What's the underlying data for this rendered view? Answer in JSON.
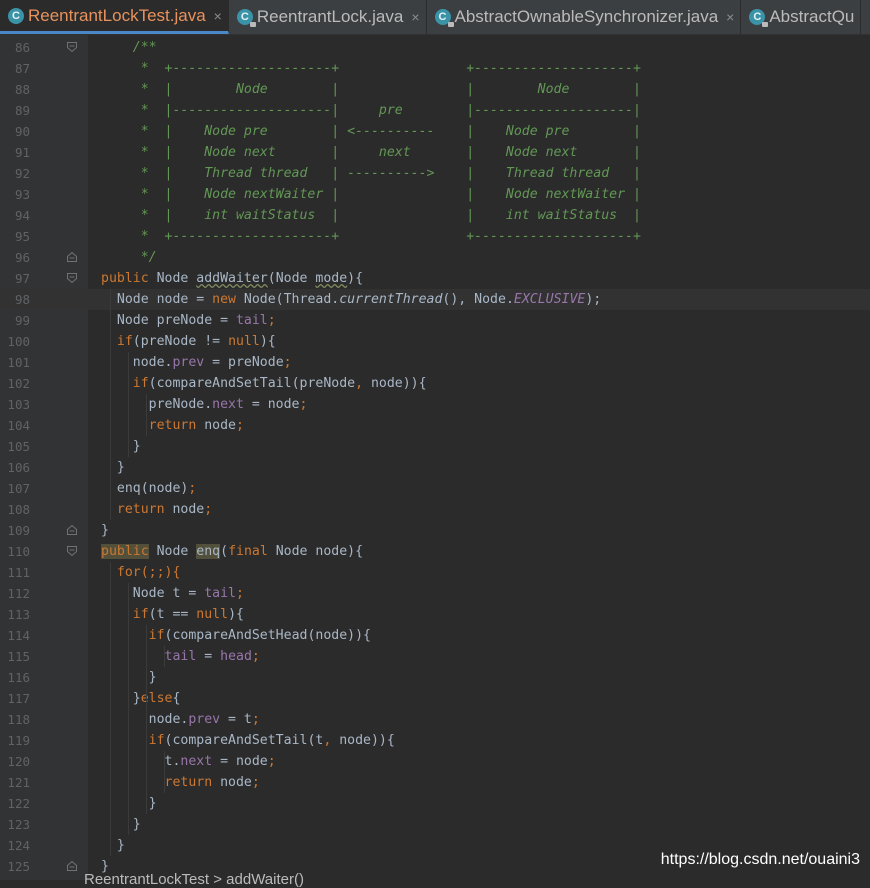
{
  "tabs": [
    {
      "label": "ReentrantLockTest.java",
      "icon": "class-icon",
      "active": true
    },
    {
      "label": "ReentrantLock.java",
      "icon": "locked-class-icon",
      "active": false
    },
    {
      "label": "AbstractOwnableSynchronizer.java",
      "icon": "locked-class-icon",
      "active": false
    },
    {
      "label": "AbstractQu",
      "icon": "locked-class-icon",
      "active": false
    }
  ],
  "current_line": 98,
  "lines": [
    {
      "n": 86,
      "fold": "open",
      "t": [
        [
          "    /**",
          "c"
        ]
      ]
    },
    {
      "n": 87,
      "t": [
        [
          "     *  +--------------------+                +--------------------+",
          "c"
        ]
      ]
    },
    {
      "n": 88,
      "t": [
        [
          "     *  |        Node        |                |        Node        |",
          "c"
        ]
      ]
    },
    {
      "n": 89,
      "t": [
        [
          "     *  |--------------------|     pre        |--------------------|",
          "c"
        ]
      ]
    },
    {
      "n": 90,
      "t": [
        [
          "     *  |    Node pre        | <----------    |    Node pre        |",
          "c"
        ]
      ]
    },
    {
      "n": 91,
      "t": [
        [
          "     *  |    Node next       |     next       |    Node next       |",
          "c"
        ]
      ]
    },
    {
      "n": 92,
      "t": [
        [
          "     *  |    Thread thread   | ---------->    |    Thread thread   |",
          "c"
        ]
      ]
    },
    {
      "n": 93,
      "t": [
        [
          "     *  |    Node nextWaiter |                |    Node nextWaiter |",
          "c"
        ]
      ]
    },
    {
      "n": 94,
      "t": [
        [
          "     *  |    int waitStatus  |                |    int waitStatus  |",
          "c"
        ]
      ]
    },
    {
      "n": 95,
      "t": [
        [
          "     *  +--------------------+                +--------------------+",
          "c"
        ]
      ]
    },
    {
      "n": 96,
      "fold": "close",
      "t": [
        [
          "     */",
          "c"
        ]
      ]
    },
    {
      "n": 97,
      "fold": "open",
      "t": [
        [
          "public",
          "k"
        ],
        [
          " Node "
        ],
        [
          "addWaiter",
          "u"
        ],
        [
          "(Node "
        ],
        [
          "mode",
          "u"
        ],
        [
          "){"
        ]
      ]
    },
    {
      "n": 98,
      "t": [
        [
          "  Node node = "
        ],
        [
          "new",
          "k"
        ],
        [
          " Node(Thread."
        ],
        [
          "currentThread",
          "st"
        ],
        [
          "(), Node."
        ],
        [
          "EXCLUSIVE",
          "sf"
        ],
        [
          ");"
        ]
      ]
    },
    {
      "n": 99,
      "t": [
        [
          "  Node preNode = "
        ],
        [
          "tail",
          "f"
        ],
        [
          ";",
          "k"
        ]
      ]
    },
    {
      "n": 100,
      "t": [
        [
          "  "
        ],
        [
          "if",
          "k"
        ],
        [
          "(preNode != "
        ],
        [
          "null",
          "k"
        ],
        [
          "){"
        ]
      ]
    },
    {
      "n": 101,
      "t": [
        [
          "    node."
        ],
        [
          "prev",
          "f"
        ],
        [
          " = preNode"
        ],
        [
          ";",
          "k"
        ]
      ]
    },
    {
      "n": 102,
      "t": [
        [
          "    "
        ],
        [
          "if",
          "k"
        ],
        [
          "(compareAndSetTail(preNode"
        ],
        [
          ",",
          "k"
        ],
        [
          " node)){"
        ]
      ]
    },
    {
      "n": 103,
      "t": [
        [
          "      preNode."
        ],
        [
          "next",
          "f"
        ],
        [
          " = node"
        ],
        [
          ";",
          "k"
        ]
      ]
    },
    {
      "n": 104,
      "t": [
        [
          "      "
        ],
        [
          "return",
          "k"
        ],
        [
          " node"
        ],
        [
          ";",
          "k"
        ]
      ]
    },
    {
      "n": 105,
      "t": [
        [
          "    }"
        ]
      ]
    },
    {
      "n": 106,
      "t": [
        [
          "  }"
        ]
      ]
    },
    {
      "n": 107,
      "t": [
        [
          "  enq(node)"
        ],
        [
          ";",
          "k"
        ]
      ]
    },
    {
      "n": 108,
      "t": [
        [
          "  "
        ],
        [
          "return",
          "k"
        ],
        [
          " node"
        ],
        [
          ";",
          "k"
        ]
      ]
    },
    {
      "n": 109,
      "fold": "close",
      "t": [
        [
          "}"
        ]
      ]
    },
    {
      "n": 110,
      "fold": "open",
      "t": [
        [
          "public",
          "k hl"
        ],
        [
          " Node "
        ],
        [
          "enq",
          "hl"
        ],
        [
          "("
        ],
        [
          "final",
          "k"
        ],
        [
          " Node node){"
        ]
      ]
    },
    {
      "n": 111,
      "t": [
        [
          "  "
        ],
        [
          "for",
          "k"
        ],
        [
          "(;;){",
          "k"
        ]
      ]
    },
    {
      "n": 112,
      "t": [
        [
          "    Node t = "
        ],
        [
          "tail",
          "f"
        ],
        [
          ";",
          "k"
        ]
      ]
    },
    {
      "n": 113,
      "t": [
        [
          "    "
        ],
        [
          "if",
          "k"
        ],
        [
          "(t == "
        ],
        [
          "null",
          "k"
        ],
        [
          "){"
        ]
      ]
    },
    {
      "n": 114,
      "t": [
        [
          "      "
        ],
        [
          "if",
          "k"
        ],
        [
          "(compareAndSetHead(node)){"
        ]
      ]
    },
    {
      "n": 115,
      "t": [
        [
          "        "
        ],
        [
          "tail",
          "f"
        ],
        [
          " = "
        ],
        [
          "head",
          "f"
        ],
        [
          ";",
          "k"
        ]
      ]
    },
    {
      "n": 116,
      "t": [
        [
          "      }"
        ]
      ]
    },
    {
      "n": 117,
      "t": [
        [
          "    }"
        ],
        [
          "else",
          "k"
        ],
        [
          "{"
        ]
      ]
    },
    {
      "n": 118,
      "t": [
        [
          "      node."
        ],
        [
          "prev",
          "f"
        ],
        [
          " = t"
        ],
        [
          ";",
          "k"
        ]
      ]
    },
    {
      "n": 119,
      "t": [
        [
          "      "
        ],
        [
          "if",
          "k"
        ],
        [
          "(compareAndSetTail(t"
        ],
        [
          ",",
          "k"
        ],
        [
          " node)){"
        ]
      ]
    },
    {
      "n": 120,
      "t": [
        [
          "        t."
        ],
        [
          "next",
          "f"
        ],
        [
          " = node"
        ],
        [
          ";",
          "k"
        ]
      ]
    },
    {
      "n": 121,
      "t": [
        [
          "        "
        ],
        [
          "return",
          "k"
        ],
        [
          " node"
        ],
        [
          ";",
          "k"
        ]
      ]
    },
    {
      "n": 122,
      "t": [
        [
          "      }"
        ]
      ]
    },
    {
      "n": 123,
      "t": [
        [
          "    }"
        ]
      ]
    },
    {
      "n": 124,
      "t": [
        [
          "  }"
        ]
      ]
    },
    {
      "n": 125,
      "fold": "close",
      "t": [
        [
          "}"
        ]
      ]
    }
  ],
  "breadcrumb": "ReentrantLockTest  >  addWaiter()",
  "watermark": "https://blog.csdn.net/ouaini3"
}
